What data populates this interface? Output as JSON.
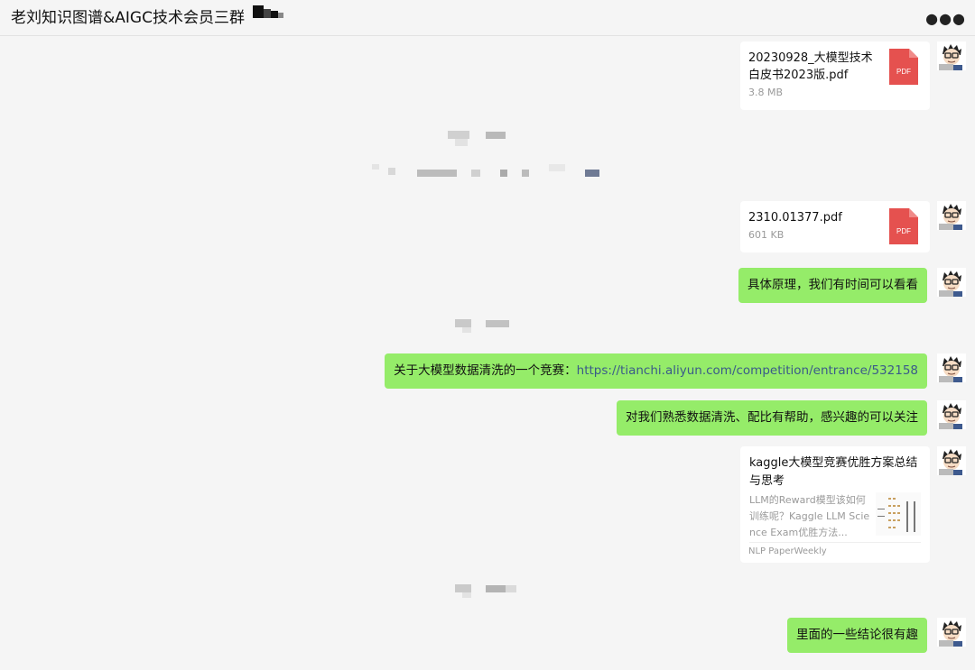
{
  "header": {
    "title": "老刘知识图谱&AIGC技术会员三群",
    "menu_icon": "more-horizontal-icon"
  },
  "messages": {
    "file1": {
      "name": "20230928_大模型技术白皮书2023版.pdf",
      "size": "3.8 MB",
      "icon": "PDF"
    },
    "file2": {
      "name": "2310.01377.pdf",
      "size": "601 KB",
      "icon": "PDF"
    },
    "text1": "具体原理，我们有时间可以看看",
    "text2_prefix": "关于大模型数据清洗的一个竞赛：",
    "text2_link": "https://tianchi.aliyun.com/competition/entrance/532158",
    "text3": "对我们熟悉数据清洗、配比有帮助，感兴趣的可以关注",
    "link_card": {
      "title": "kaggle大模型竞赛优胜方案总结与思考",
      "description": "LLM的Reward模型该如何训练呢？Kaggle LLM Science Exam优胜方法...",
      "source": "NLP PaperWeekly"
    },
    "text4": "里面的一些结论很有趣"
  },
  "colors": {
    "background": "#f5f5f5",
    "bubble_green": "#95ec69",
    "card_white": "#ffffff",
    "pdf_red": "#e5514f",
    "link_text": "#3a5a8a"
  }
}
